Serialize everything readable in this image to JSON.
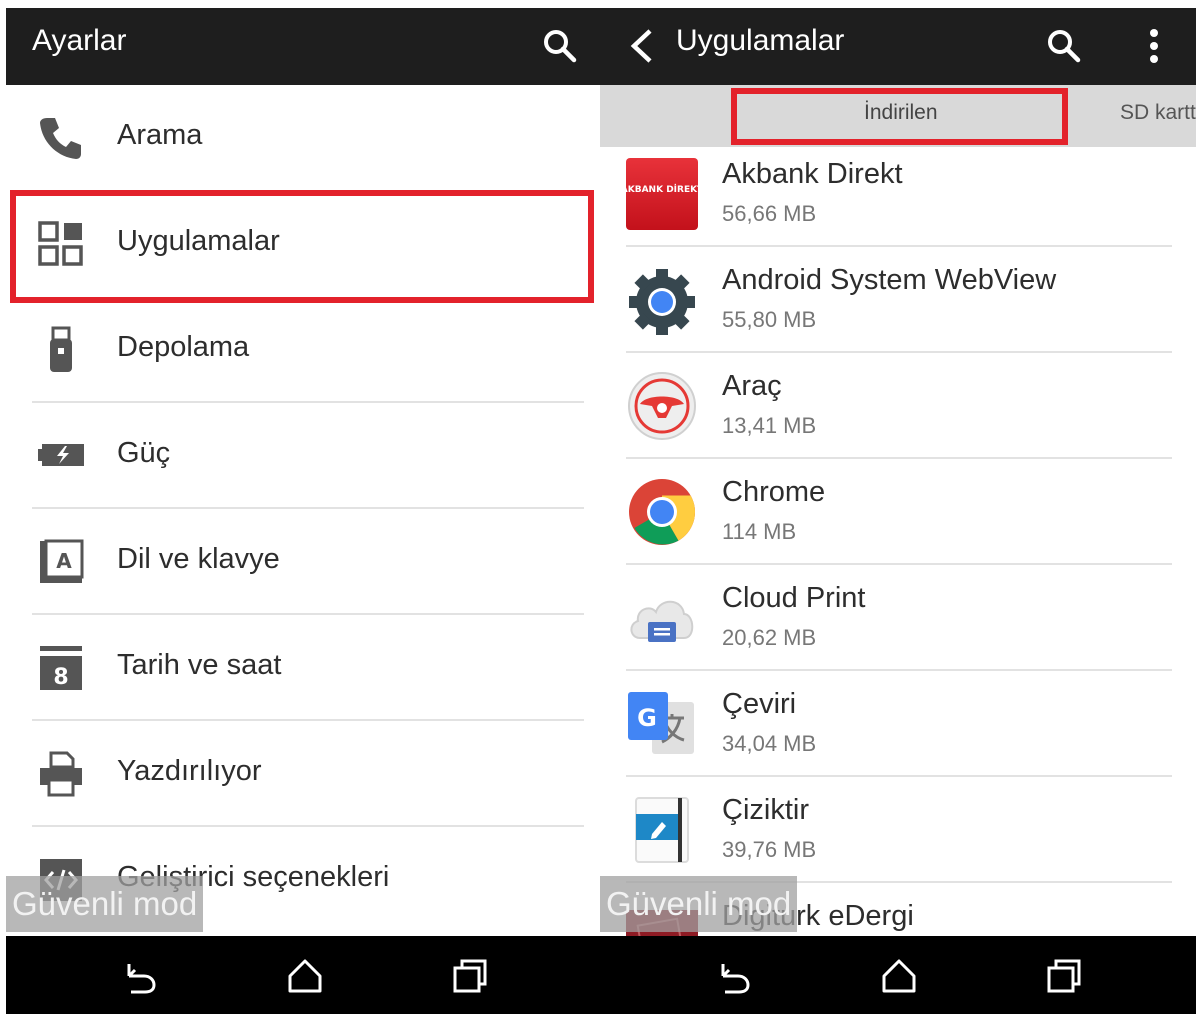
{
  "left": {
    "title": "Ayarlar",
    "items": [
      {
        "label": "Arama",
        "icon": "phone-icon"
      },
      {
        "label": "Uygulamalar",
        "icon": "apps-grid-icon",
        "highlighted": true
      },
      {
        "label": "Depolama",
        "icon": "usb-storage-icon"
      },
      {
        "label": "Güç",
        "icon": "battery-icon"
      },
      {
        "label": "Dil ve klavye",
        "icon": "language-icon"
      },
      {
        "label": "Tarih ve saat",
        "icon": "calendar-icon"
      },
      {
        "label": "Yazdırılıyor",
        "icon": "printer-icon"
      },
      {
        "label": "Geliştirici seçenekleri",
        "icon": "developer-code-icon"
      }
    ],
    "calendar_day": "8",
    "language_letter": "A",
    "watermark": "Güvenli mod"
  },
  "right": {
    "title": "Uygulamalar",
    "tabs": {
      "active": "İndirilen",
      "next": "SD kartt"
    },
    "apps": [
      {
        "name": "Akbank Direkt",
        "size": "56,66 MB",
        "icon_text": "AKBANK DİREKT"
      },
      {
        "name": "Android System WebView",
        "size": "55,80 MB"
      },
      {
        "name": "Araç",
        "size": "13,41 MB"
      },
      {
        "name": "Chrome",
        "size": "114 MB"
      },
      {
        "name": "Cloud Print",
        "size": "20,62 MB"
      },
      {
        "name": "Çeviri",
        "size": "34,04 MB"
      },
      {
        "name": "Çiziktir",
        "size": "39,76 MB"
      },
      {
        "name": "Digiturk eDergi",
        "size": ""
      }
    ],
    "watermark": "Güvenli mod"
  },
  "colors": {
    "appbar": "#1e1e1e",
    "highlight": "#e3222b",
    "tab_bg": "#d9d9d9",
    "navbar": "#000000"
  }
}
